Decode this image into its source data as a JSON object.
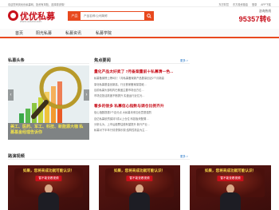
{
  "topbar": {
    "welcome": "欢迎您来到优优私募网，投资有风险，选择需谨慎！",
    "links": [
      "东方财富",
      "东方投资基金",
      "登录",
      "APP下载"
    ]
  },
  "logo": {
    "name": "优优私募",
    "url": "www.uufund.com"
  },
  "search": {
    "category": "产品",
    "placeholder": "产品名称/公司简称"
  },
  "hotline": {
    "label": "咨询热线",
    "number": "95357转6"
  },
  "nav": {
    "items": [
      "首页",
      "阳光私募",
      "私募资讯",
      "私募学院"
    ]
  },
  "news_section": {
    "title": "私募头条"
  },
  "hot_section": {
    "title": "焦点要闻",
    "more": "更多 >"
  },
  "banner": {
    "caption": "美工、医药、军工、科技、新能源大咖 私募基金经理告诉你"
  },
  "headlines": [
    {
      "title": "量化产品太好卖了 7月备案量前十私募清一色...",
      "lines": [
        "私募备案榜上榜8月！7月私募备案新产品数量创近2个月新高",
        "量化私募基金创新高，行业首家备案量突破…",
        "目前私募头部机构已覆盖主要市场全方位…",
        "市场交投活跃度不断提升 实盘运行近亿元…"
      ]
    },
    {
      "title": "看多的很多 私募信心指数与调仓比例齐升",
      "lines": [
        "信心指数提振2个百分点 大私募未来加仓意愿强烈",
        "百亿私募依然保持7成以上仓位 科技板块配置…",
        "分析认为，上市后股票估值有望提升 新兴产业…",
        "私募对下半年行情谨慎乐观 结构性机会为主…"
      ]
    }
  ],
  "video_section": {
    "title": "路演视频",
    "more": "更多 >"
  },
  "videos": [
    {
      "headline": "如果，您将来成功就可能认识！",
      "badge": "暂不能查看视频"
    },
    {
      "headline": "如果，您将来成功就可能认识！",
      "badge": "暂不能查看视频"
    },
    {
      "headline": "如果，您将来成功就可能认识！",
      "badge": "暂不能查看视频"
    }
  ]
}
